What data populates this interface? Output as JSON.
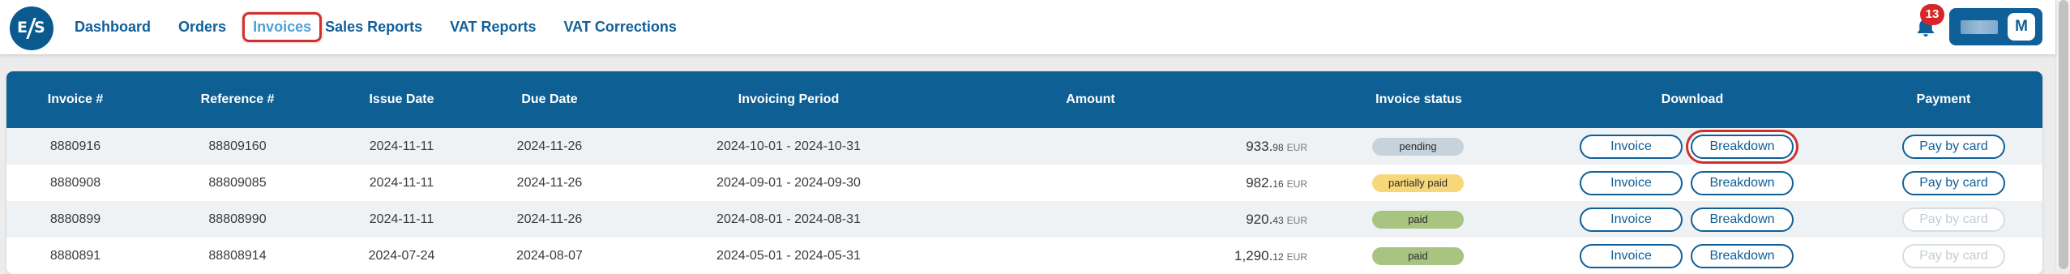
{
  "logo": {
    "left": "E",
    "right": "S"
  },
  "nav": {
    "items": [
      {
        "label": "Dashboard",
        "active": false
      },
      {
        "label": "Orders",
        "active": false
      },
      {
        "label": "Invoices",
        "active": true
      },
      {
        "label": "Sales Reports",
        "active": false
      },
      {
        "label": "VAT Reports",
        "active": false
      },
      {
        "label": "VAT Corrections",
        "active": false
      }
    ]
  },
  "notifications": {
    "count": "13"
  },
  "user": {
    "initial": "M"
  },
  "colors": {
    "primary": "#0d5f94",
    "highlight": "#d0302f",
    "pending": "#c7d3dc",
    "partially_paid": "#f6d77a",
    "paid": "#a7c481"
  },
  "table": {
    "headers": [
      "Invoice #",
      "Reference #",
      "Issue Date",
      "Due Date",
      "Invoicing Period",
      "Amount",
      "Invoice status",
      "Download",
      "Payment"
    ],
    "rows": [
      {
        "invoice": "8880916",
        "reference": "88809160",
        "issue_date": "2024-11-11",
        "due_date": "2024-11-26",
        "period": "2024-10-01 - 2024-10-31",
        "amount_main": "933.",
        "amount_cents": "98",
        "currency": "EUR",
        "status": "pending",
        "btn_invoice": "Invoice",
        "btn_breakdown": "Breakdown",
        "btn_pay": "Pay by card"
      },
      {
        "invoice": "8880908",
        "reference": "88809085",
        "issue_date": "2024-11-11",
        "due_date": "2024-11-26",
        "period": "2024-09-01 - 2024-09-30",
        "amount_main": "982.",
        "amount_cents": "16",
        "currency": "EUR",
        "status": "partially paid",
        "btn_invoice": "Invoice",
        "btn_breakdown": "Breakdown",
        "btn_pay": "Pay by card"
      },
      {
        "invoice": "8880899",
        "reference": "88808990",
        "issue_date": "2024-11-11",
        "due_date": "2024-11-26",
        "period": "2024-08-01 - 2024-08-31",
        "amount_main": "920.",
        "amount_cents": "43",
        "currency": "EUR",
        "status": "paid",
        "btn_invoice": "Invoice",
        "btn_breakdown": "Breakdown",
        "btn_pay": "Pay by card"
      },
      {
        "invoice": "8880891",
        "reference": "88808914",
        "issue_date": "2024-07-24",
        "due_date": "2024-08-07",
        "period": "2024-05-01 - 2024-05-31",
        "amount_main": "1,290.",
        "amount_cents": "12",
        "currency": "EUR",
        "status": "paid",
        "btn_invoice": "Invoice",
        "btn_breakdown": "Breakdown",
        "btn_pay": "Pay by card"
      }
    ]
  }
}
